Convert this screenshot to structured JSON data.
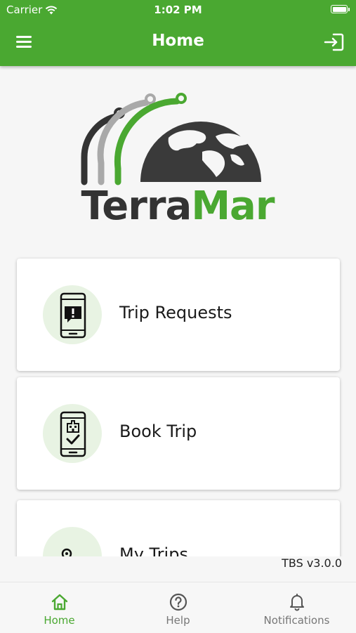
{
  "status_bar": {
    "carrier": "Carrier",
    "time": "1:02 PM"
  },
  "header": {
    "title": "Home",
    "menu_icon": "hamburger-menu-icon",
    "logout_icon": "logout-icon"
  },
  "logo": {
    "word_dark": "Terra",
    "word_green": "Mar"
  },
  "cards": [
    {
      "label": "Trip Requests",
      "icon": "phone-alert-icon"
    },
    {
      "label": "Book Trip",
      "icon": "phone-building-check-icon"
    },
    {
      "label": "My Trips",
      "icon": "route-pin-icon"
    }
  ],
  "version": "TBS v3.0.0",
  "tabs": [
    {
      "label": "Home",
      "icon": "home-icon",
      "active": true
    },
    {
      "label": "Help",
      "icon": "help-circle-icon",
      "active": false
    },
    {
      "label": "Notifications",
      "icon": "bell-icon",
      "active": false
    }
  ],
  "colors": {
    "brand_green": "#4aa831",
    "dark": "#333333",
    "inactive_tab": "#777777",
    "icon_circle": "#e8f3e3"
  }
}
